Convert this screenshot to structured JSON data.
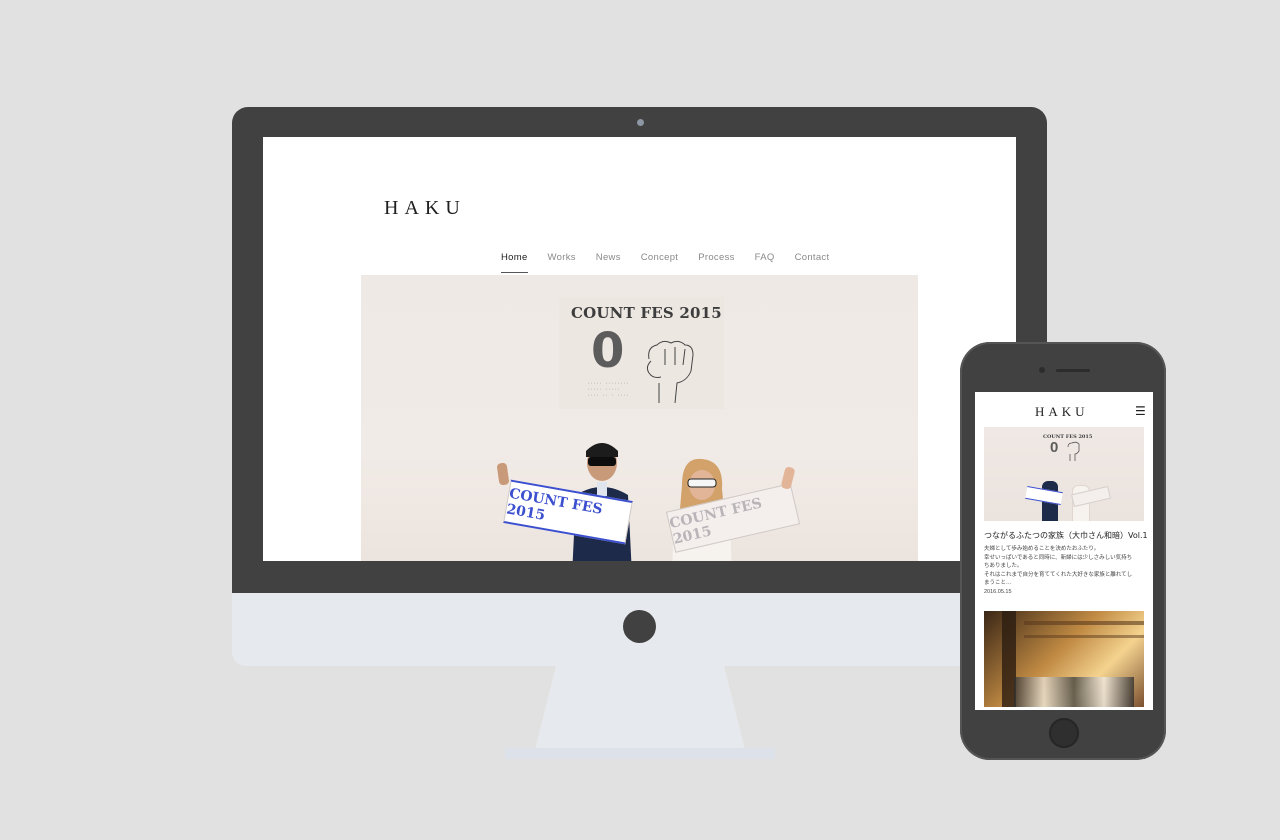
{
  "desktop": {
    "site_logo": "HAKU",
    "nav": [
      {
        "label": "Home",
        "active": true
      },
      {
        "label": "Works",
        "active": false
      },
      {
        "label": "News",
        "active": false
      },
      {
        "label": "Concept",
        "active": false
      },
      {
        "label": "Process",
        "active": false
      },
      {
        "label": "FAQ",
        "active": false
      },
      {
        "label": "Contact",
        "active": false
      }
    ],
    "hero": {
      "poster_title": "COUNT FES 2015",
      "poster_number": "0",
      "banner_left": "COUNT FES 2015",
      "banner_right": "COUNT FES 2015"
    }
  },
  "mobile": {
    "site_logo": "HAKU",
    "menu_icon": "hamburger-icon",
    "menu_glyph": "☰",
    "hero_poster_title": "COUNT FES 2015",
    "hero_poster_number": "0",
    "article": {
      "title": "つながるふたつの家族（大巾さん和暗）Vol.1",
      "body_lines": [
        "夫婦として歩み始めることを決めたおふたり。",
        "幸せいっぱいであると同時に、新婦には少しさみしい気持ち",
        "ちありました。",
        "それはこれまで自分を育ててくれた大好きな家族と離れてし",
        "まうこと…"
      ],
      "date": "2016.05.15"
    }
  },
  "colors": {
    "device_dark": "#414141",
    "device_light": "#e6e9ee",
    "background": "#e1e1e1",
    "banner_blue": "#3b4fcf"
  }
}
